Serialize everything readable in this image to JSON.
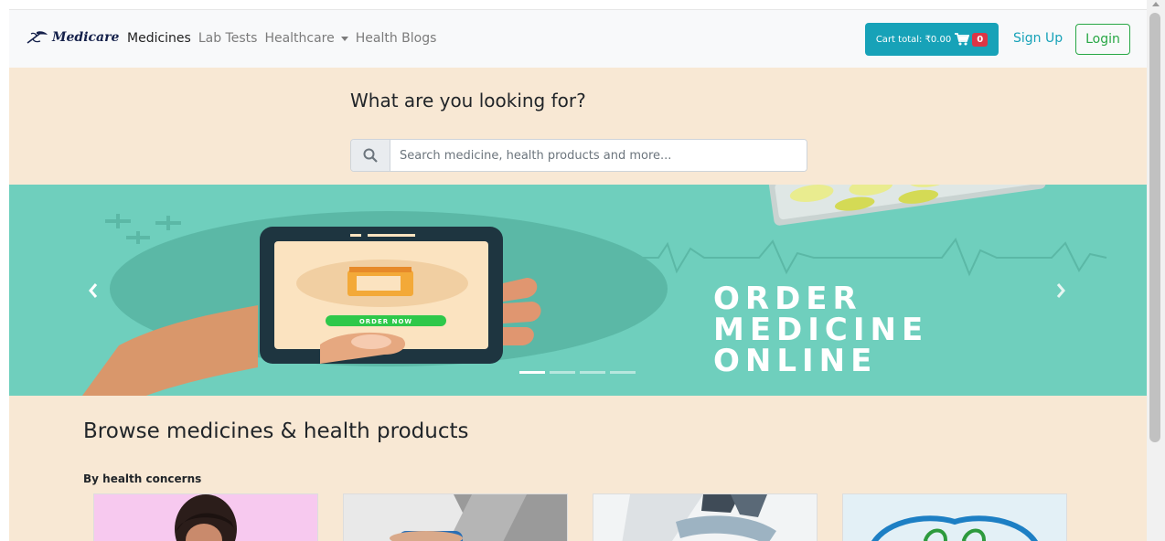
{
  "navbar": {
    "brand": "Medicare",
    "links": [
      {
        "label": "Medicines"
      },
      {
        "label": "Lab Tests"
      },
      {
        "label": "Healthcare"
      },
      {
        "label": "Health Blogs"
      }
    ],
    "cart_label": "Cart total: ₹0.00",
    "cart_count": "0",
    "signup": "Sign Up",
    "login": "Login"
  },
  "search": {
    "title": "What are you looking for?",
    "placeholder": "Search medicine, health products and more..."
  },
  "carousel": {
    "cta": "ORDER NOW",
    "headline": [
      "ORDER",
      "MEDICINE",
      "ONLINE"
    ]
  },
  "browse": {
    "title": "Browse medicines & health products",
    "subtitle": "By health concerns"
  },
  "colors": {
    "accent": "#17a2b8",
    "success": "#28a745",
    "danger": "#dc3545",
    "section_bg": "#f8e8d4",
    "banner_bg": "#6fcfbd"
  }
}
